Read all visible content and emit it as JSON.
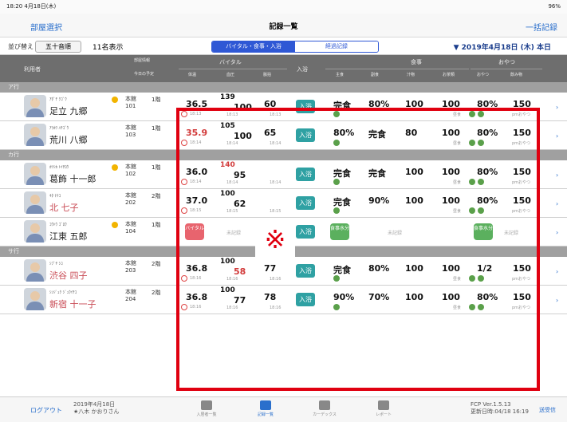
{
  "status_bar": {
    "time": "18:20",
    "date": "4月18日(木)",
    "battery": "96%"
  },
  "nav": {
    "left": "部屋選択",
    "title": "記録一覧",
    "right": "一括記録"
  },
  "toolbar": {
    "sort_label": "並び替え",
    "sort_value": "五十音順",
    "count": "11名表示",
    "tabs": [
      "バイタル・食事・入浴",
      "経過記録"
    ],
    "date": "▼ 2019年4月18日 (木) 本日"
  },
  "header": {
    "user": "利用者",
    "room": "部屋情報",
    "plan": "今日の予定",
    "vital": "バイタル",
    "temp": "体温",
    "bp": "血圧",
    "pulse": "脈拍",
    "bath": "入浴",
    "meal": "食事",
    "staple": "主食",
    "side": "副食",
    "soup": "汁物",
    "drink": "お茶類",
    "snack": "おやつ",
    "snack_food": "おやつ",
    "snack_drink": "飲み物"
  },
  "sections": [
    "ア行",
    "カ行",
    "サ行"
  ],
  "rows": [
    {
      "kana": "ｱﾀﾞﾁ ｸｺﾞｳ",
      "name": "足立 九郷",
      "ward": "本館",
      "room": "101",
      "floor": "1階",
      "temp": "36.5",
      "bp_hi": "139",
      "bp_lo": "100",
      "pulse": "60",
      "time": "18:13",
      "bath": "入浴",
      "staple": "完食",
      "side": "80%",
      "soup": "100",
      "drink": "100",
      "snack": "80%",
      "snack_drink": "150",
      "snack_label": "pmおやつ",
      "meal_label": "昼食"
    },
    {
      "kana": "ｱﾗｶﾜ ﾊﾁｺﾞｳ",
      "name": "荒川 八郷",
      "ward": "本館",
      "room": "103",
      "floor": "1階",
      "temp": "35.9",
      "bp_hi": "105",
      "bp_lo": "100",
      "pulse": "65",
      "time": "18:14",
      "bath": "入浴",
      "staple": "80%",
      "side": "完食",
      "soup": "80",
      "drink": "100",
      "snack": "80%",
      "snack_drink": "150",
      "snack_label": "pmおやつ",
      "meal_label": "昼食"
    },
    {
      "kana": "ｶﾂｼｶ ﾄｲﾁﾛｳ",
      "name": "葛飾 十一郎",
      "ward": "本館",
      "room": "102",
      "floor": "1階",
      "temp": "36.0",
      "bp_hi": "140",
      "bp_lo": "95",
      "pulse": "",
      "time": "18:14",
      "bath": "入浴",
      "staple": "完食",
      "side": "完食",
      "soup": "100",
      "drink": "100",
      "snack": "80%",
      "snack_drink": "150",
      "snack_label": "pmおやつ",
      "meal_label": "昼食"
    },
    {
      "kana": "ｷﾀ ﾅﾅｺ",
      "name": "北 七子",
      "ward": "本館",
      "room": "202",
      "floor": "2階",
      "temp": "37.0",
      "bp_hi": "100",
      "bp_lo": "62",
      "pulse": "",
      "time": "18:15",
      "bath": "入浴",
      "staple": "完食",
      "side": "90%",
      "soup": "100",
      "drink": "100",
      "snack": "80%",
      "snack_drink": "150",
      "snack_label": "pmおやつ",
      "meal_label": "昼食"
    },
    {
      "kana": "ｺｳﾄｳ ｺﾞﾛｳ",
      "name": "江東 五郎",
      "ward": "本館",
      "room": "104",
      "floor": "1階",
      "vital_pill": "バイタル",
      "unrecorded": "未記録",
      "bath": "入浴",
      "meal_pill": "食事水分"
    },
    {
      "kana": "ｼﾌﾞﾔ ｼｺ",
      "name": "渋谷 四子",
      "ward": "本館",
      "room": "203",
      "floor": "2階",
      "temp": "36.8",
      "bp_hi": "100",
      "bp_lo": "58",
      "pulse": "77",
      "time": "18:16",
      "bath": "入浴",
      "staple": "完食",
      "side": "80%",
      "soup": "100",
      "drink": "100",
      "snack": "1/2",
      "snack_drink": "150",
      "snack_label": "pmおやつ",
      "meal_label": "昼食"
    },
    {
      "kana": "ｼﾝｼﾞｭｸ ｼﾞｭｳｲﾁｺ",
      "name": "新宿 十一子",
      "ward": "本館",
      "room": "204",
      "floor": "2階",
      "temp": "36.8",
      "bp_hi": "100",
      "bp_lo": "77",
      "pulse": "78",
      "time": "18:16",
      "bath": "入浴",
      "staple": "90%",
      "side": "70%",
      "soup": "100",
      "drink": "100",
      "snack": "80%",
      "snack_drink": "150",
      "snack_label": "pmおやつ",
      "meal_label": "昼食"
    }
  ],
  "footer": {
    "logout": "ログアウト",
    "date": "2019年4月18日",
    "staff": "★八木 かおりさん",
    "tabs": [
      "入居者一覧",
      "記録一覧",
      "カーデックス",
      "レポート"
    ],
    "version": "FCP Ver.1.5.13",
    "updated": "更新日時:04/18 16:19",
    "send": "送受信",
    "mark": "※"
  }
}
